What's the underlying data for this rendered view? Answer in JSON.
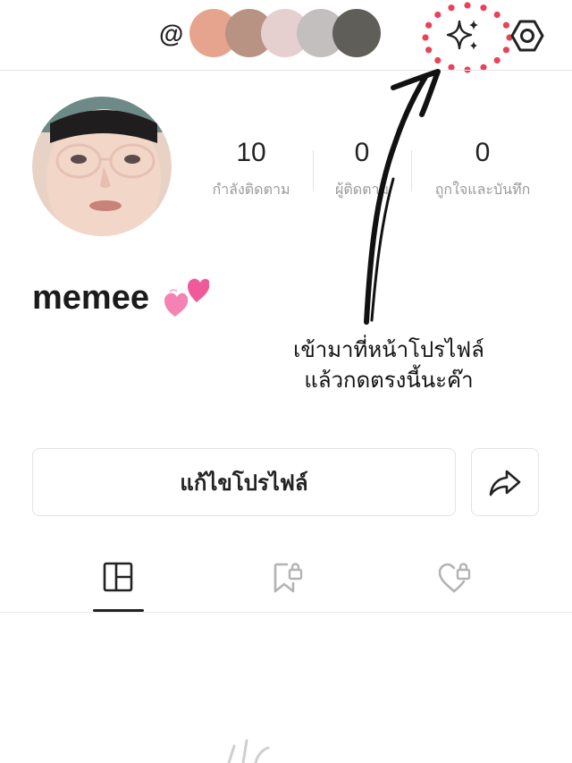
{
  "header": {
    "username_prefix": "@",
    "swatch_colors": [
      "#E6A48E",
      "#B89282",
      "#E5CFCF",
      "#C4BFBF",
      "#5F5E58"
    ],
    "sparkle_icon": "sparkle-icon",
    "settings_icon": "gear-icon"
  },
  "profile": {
    "display_name": "memee",
    "name_emoji": "💞",
    "stats": [
      {
        "value": "10",
        "label": "กำลังติดตาม"
      },
      {
        "value": "0",
        "label": "ผู้ติดตาม"
      },
      {
        "value": "0",
        "label": "ถูกใจและบันทึก"
      }
    ]
  },
  "annotation": {
    "lines": [
      "เข้ามาที่หน้าโปรไฟล์",
      "แล้วกดตรงนี้นะค๊า"
    ],
    "highlight_color": "#E8425A"
  },
  "actions": {
    "edit_profile_label": "แก้ไขโปรไฟล์",
    "share_icon": "share-icon"
  },
  "tabs": [
    {
      "icon": "grid-icon",
      "selected": true
    },
    {
      "icon": "bookmark-lock-icon",
      "selected": false
    },
    {
      "icon": "heart-lock-icon",
      "selected": false
    }
  ]
}
